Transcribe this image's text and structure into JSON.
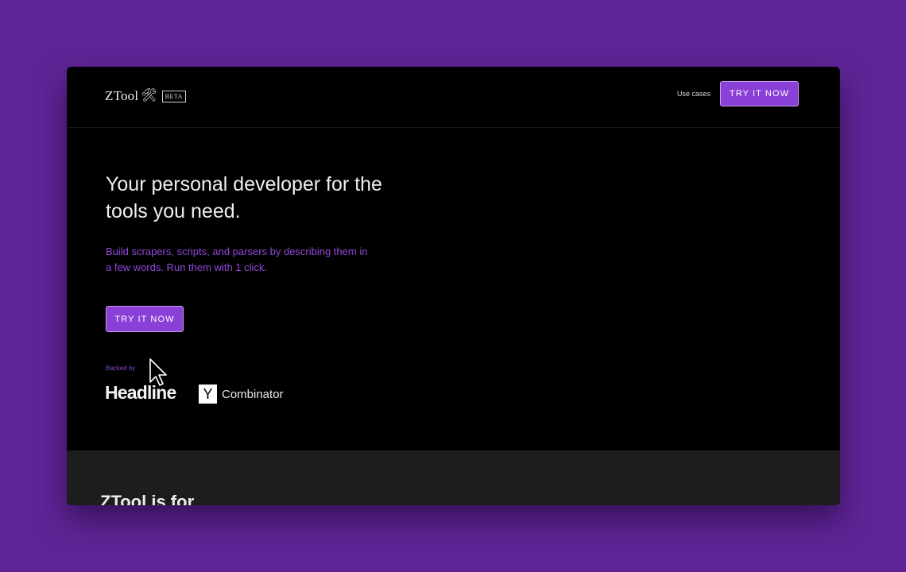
{
  "nav": {
    "logo_text": "ZTool",
    "logo_icon": "🛠",
    "beta_label": "BETA",
    "use_cases_link": "Use cases",
    "cta_label": "TRY IT NOW"
  },
  "hero": {
    "title": "Your personal developer for the tools you need.",
    "subtitle": "Build scrapers, scripts, and parsers by describing them in a few words. Run them with 1 click.",
    "cta_label": "TRY IT NOW",
    "backed_by_label": "Backed by",
    "backers": {
      "headline": "Headline",
      "yc_mark": "Y",
      "yc_name": "Combinator"
    }
  },
  "section_two": {
    "title": "ZTool is for"
  },
  "colors": {
    "background": "#5f2597",
    "accent": "#8a3fd6",
    "accent_text": "#9148d9"
  }
}
